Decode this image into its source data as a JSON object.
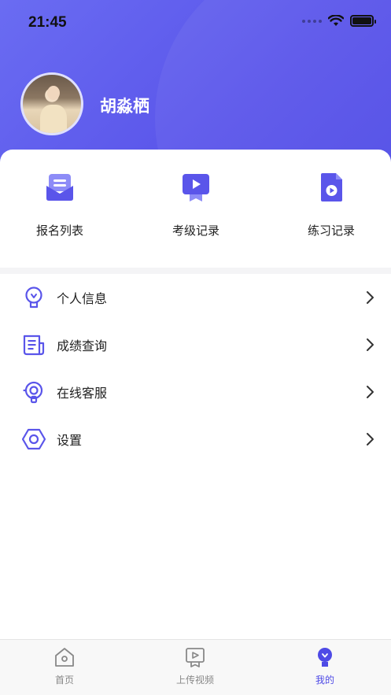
{
  "status_bar": {
    "time": "21:45"
  },
  "profile": {
    "name": "胡淼栖"
  },
  "quick_actions": [
    {
      "label": "报名列表",
      "icon": "envelope-list-icon"
    },
    {
      "label": "考级记录",
      "icon": "video-badge-icon"
    },
    {
      "label": "练习记录",
      "icon": "video-file-icon"
    }
  ],
  "menu": [
    {
      "label": "个人信息",
      "icon": "user-bulb-icon"
    },
    {
      "label": "成绩查询",
      "icon": "document-list-icon"
    },
    {
      "label": "在线客服",
      "icon": "headset-icon"
    },
    {
      "label": "设置",
      "icon": "hexagon-settings-icon"
    }
  ],
  "tabbar": {
    "items": [
      {
        "label": "首页",
        "icon": "home-icon",
        "active": false
      },
      {
        "label": "上传视频",
        "icon": "upload-video-icon",
        "active": false
      },
      {
        "label": "我的",
        "icon": "profile-icon",
        "active": true
      }
    ]
  },
  "colors": {
    "accent": "#5a55ea",
    "tab_active": "#4e4ae6",
    "tab_inactive": "#888888"
  }
}
